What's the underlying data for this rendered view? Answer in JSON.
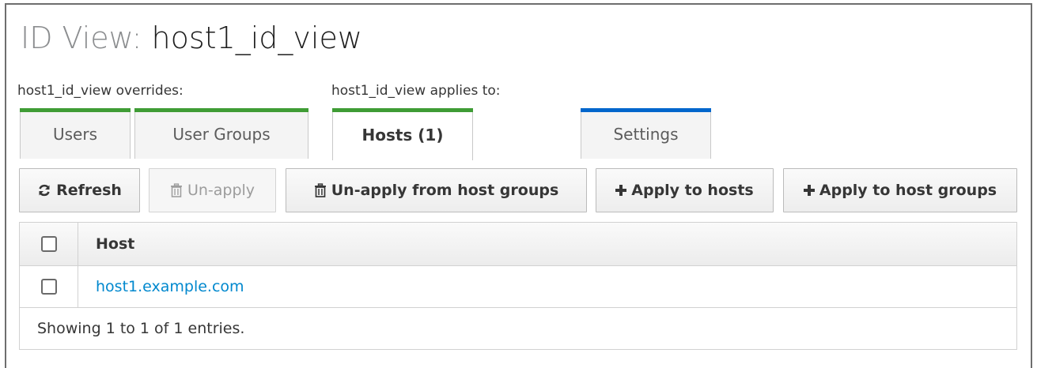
{
  "page": {
    "title_prefix": "ID View:",
    "title_name": "host1_id_view"
  },
  "groups": {
    "overrides_label": "host1_id_view overrides:",
    "applies_label": "host1_id_view applies to:"
  },
  "tabs": [
    {
      "label": "Users",
      "accent": "#3f9c35"
    },
    {
      "label": "User Groups",
      "accent": "#3f9c35"
    },
    {
      "label": "Hosts (1)",
      "accent": "#3f9c35",
      "active": true
    },
    {
      "label": "Settings",
      "accent": "#0066cc"
    }
  ],
  "toolbar": {
    "refresh_label": "Refresh",
    "unapply_label": "Un-apply",
    "unapply_groups_label": "Un-apply from host groups",
    "apply_hosts_label": "Apply to hosts",
    "apply_groups_label": "Apply to host groups"
  },
  "table": {
    "column_host": "Host",
    "rows": [
      {
        "host": "host1.example.com"
      }
    ],
    "footer": "Showing 1 to 1 of 1 entries."
  },
  "icons": {
    "refresh": "refresh-icon",
    "trash": "trash-icon",
    "plus": "plus-icon"
  },
  "colors": {
    "link": "#0088ce",
    "tab_accent_green": "#3f9c35",
    "tab_accent_blue": "#0066cc"
  }
}
